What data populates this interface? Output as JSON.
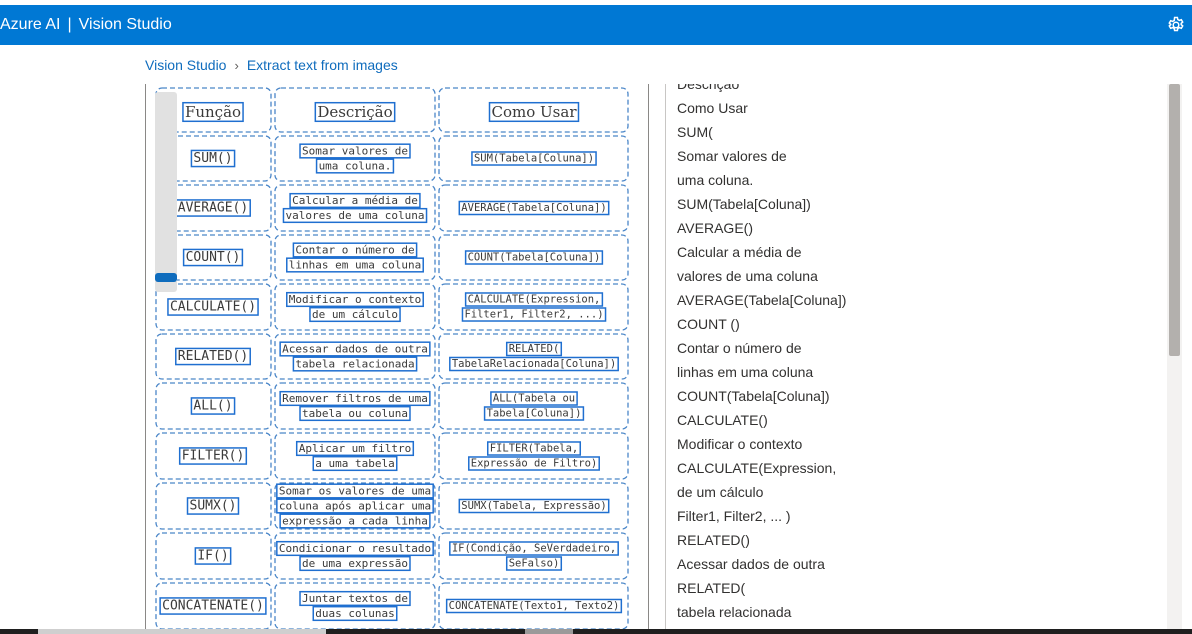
{
  "app": {
    "brand_left": "Azure AI",
    "brand_sep": "|",
    "brand_right": "Vision Studio",
    "settings_icon": "gear-icon"
  },
  "breadcrumb": {
    "items": [
      "Vision Studio",
      "Extract text from images"
    ],
    "separator_icon": "chevron-right-icon"
  },
  "colors": {
    "header_bg": "#0078d4",
    "box_outline": "#1f6fd0",
    "link": "#0f6cbd"
  },
  "image_table": {
    "headers": [
      "Função",
      "Descrição",
      "Como Usar"
    ],
    "rows": [
      {
        "fn": "SUM()",
        "desc": [
          "Somar valores de",
          "uma coluna."
        ],
        "use": [
          "SUM(Tabela[Coluna])"
        ]
      },
      {
        "fn": "AVERAGE()",
        "desc": [
          "Calcular a média de",
          "valores de uma coluna"
        ],
        "use": [
          "AVERAGE(Tabela[Coluna])"
        ]
      },
      {
        "fn": "COUNT()",
        "desc": [
          "Contar o número de",
          "linhas em uma coluna"
        ],
        "use": [
          "COUNT(Tabela[Coluna])"
        ]
      },
      {
        "fn": "CALCULATE()",
        "desc": [
          "Modificar o contexto",
          "de um cálculo"
        ],
        "use": [
          "CALCULATE(Expression,",
          "Filter1, Filter2, ...)"
        ]
      },
      {
        "fn": "RELATED()",
        "desc": [
          "Acessar dados de outra",
          "tabela relacionada"
        ],
        "use": [
          "RELATED(",
          "TabelaRelacionada[Coluna])"
        ]
      },
      {
        "fn": "ALL()",
        "desc": [
          "Remover filtros de uma",
          "tabela ou coluna"
        ],
        "use": [
          "ALL(Tabela ou",
          "Tabela[Coluna])"
        ]
      },
      {
        "fn": "FILTER()",
        "desc": [
          "Aplicar um filtro",
          "a uma tabela"
        ],
        "use": [
          "FILTER(Tabela,",
          "Expressão de Filtro)"
        ]
      },
      {
        "fn": "SUMX()",
        "desc": [
          "Somar os valores de uma",
          "coluna após aplicar uma",
          "expressão a cada linha"
        ],
        "use": [
          "SUMX(Tabela, Expressão)"
        ]
      },
      {
        "fn": "IF()",
        "desc": [
          "Condicionar o resultado",
          "de uma expressão"
        ],
        "use": [
          "IF(Condição, SeVerdadeiro,",
          "SeFalso)"
        ]
      },
      {
        "fn": "CONCATENATE()",
        "desc": [
          "Juntar textos de",
          "duas colunas"
        ],
        "use": [
          "CONCATENATE(Texto1, Texto2)"
        ]
      }
    ]
  },
  "extracted_lines": [
    "Descrição",
    "Como Usar",
    "SUM(",
    "Somar valores de",
    "uma coluna.",
    "SUM(Tabela[Coluna])",
    "AVERAGE()",
    "Calcular a média de",
    "valores de uma coluna",
    "AVERAGE(Tabela[Coluna])",
    "COUNT ()",
    "Contar o número de",
    "linhas em uma coluna",
    "COUNT(Tabela[Coluna])",
    "CALCULATE()",
    "Modificar o contexto",
    "CALCULATE(Expression,",
    "de um cálculo",
    "Filter1, Filter2, ... )",
    "RELATED()",
    "Acessar dados de outra",
    "RELATED(",
    "tabela relacionada"
  ]
}
